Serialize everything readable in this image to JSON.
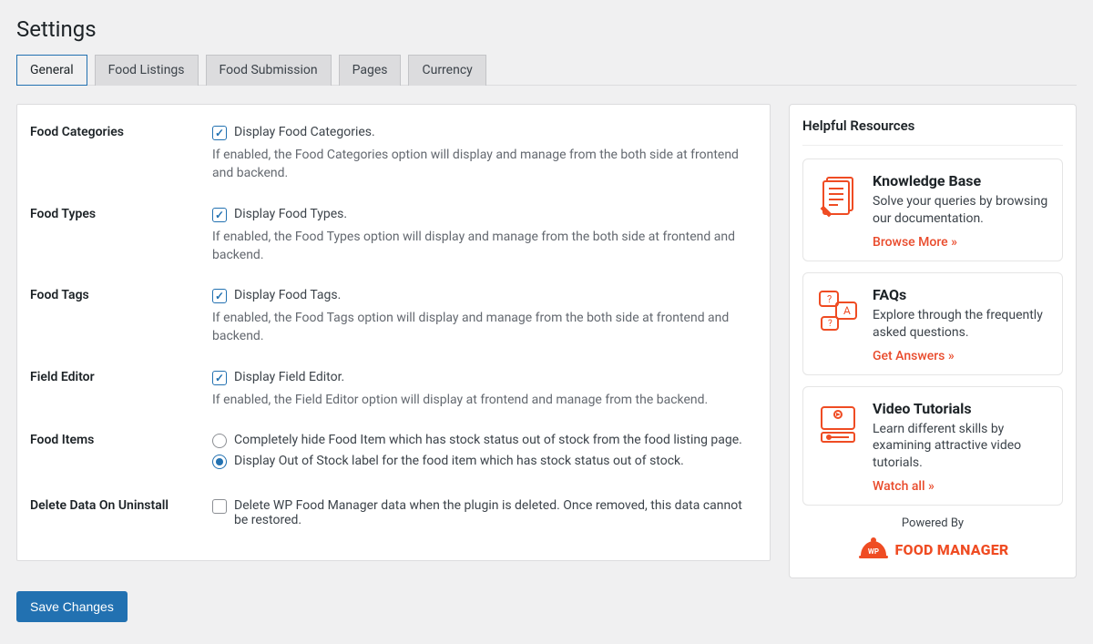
{
  "page_title": "Settings",
  "tabs": [
    {
      "label": "General",
      "active": true
    },
    {
      "label": "Food Listings",
      "active": false
    },
    {
      "label": "Food Submission",
      "active": false
    },
    {
      "label": "Pages",
      "active": false
    },
    {
      "label": "Currency",
      "active": false
    }
  ],
  "settings": {
    "food_categories": {
      "label": "Food Categories",
      "checkbox_label": "Display Food Categories.",
      "checked": true,
      "desc": "If enabled, the Food Categories option will display and manage from the both side at frontend and backend."
    },
    "food_types": {
      "label": "Food Types",
      "checkbox_label": "Display Food Types.",
      "checked": true,
      "desc": "If enabled, the Food Types option will display and manage from the both side at frontend and backend."
    },
    "food_tags": {
      "label": "Food Tags",
      "checkbox_label": "Display Food Tags.",
      "checked": true,
      "desc": "If enabled, the Food Tags option will display and manage from the both side at frontend and backend."
    },
    "field_editor": {
      "label": "Field Editor",
      "checkbox_label": "Display Field Editor.",
      "checked": true,
      "desc": "If enabled, the Field Editor option will display at frontend and manage from the backend."
    },
    "food_items": {
      "label": "Food Items",
      "options": [
        {
          "label": "Completely hide Food Item which has stock status out of stock from the food listing page.",
          "selected": false
        },
        {
          "label": "Display Out of Stock label for the food item which has stock status out of stock.",
          "selected": true
        }
      ]
    },
    "delete_data": {
      "label": "Delete Data On Uninstall",
      "checkbox_label": "Delete WP Food Manager data when the plugin is deleted. Once removed, this data cannot be restored.",
      "checked": false
    }
  },
  "save_button": "Save Changes",
  "sidebar": {
    "heading": "Helpful Resources",
    "resources": [
      {
        "title": "Knowledge Base",
        "desc": "Solve your queries by browsing our documentation.",
        "link": "Browse More »"
      },
      {
        "title": "FAQs",
        "desc": "Explore through the frequently asked questions.",
        "link": "Get Answers »"
      },
      {
        "title": "Video Tutorials",
        "desc": "Learn different skills by examining attractive video tutorials.",
        "link": "Watch all »"
      }
    ],
    "powered_by": "Powered By",
    "brand": "FOOD MANAGER",
    "brand_badge": "WP"
  }
}
